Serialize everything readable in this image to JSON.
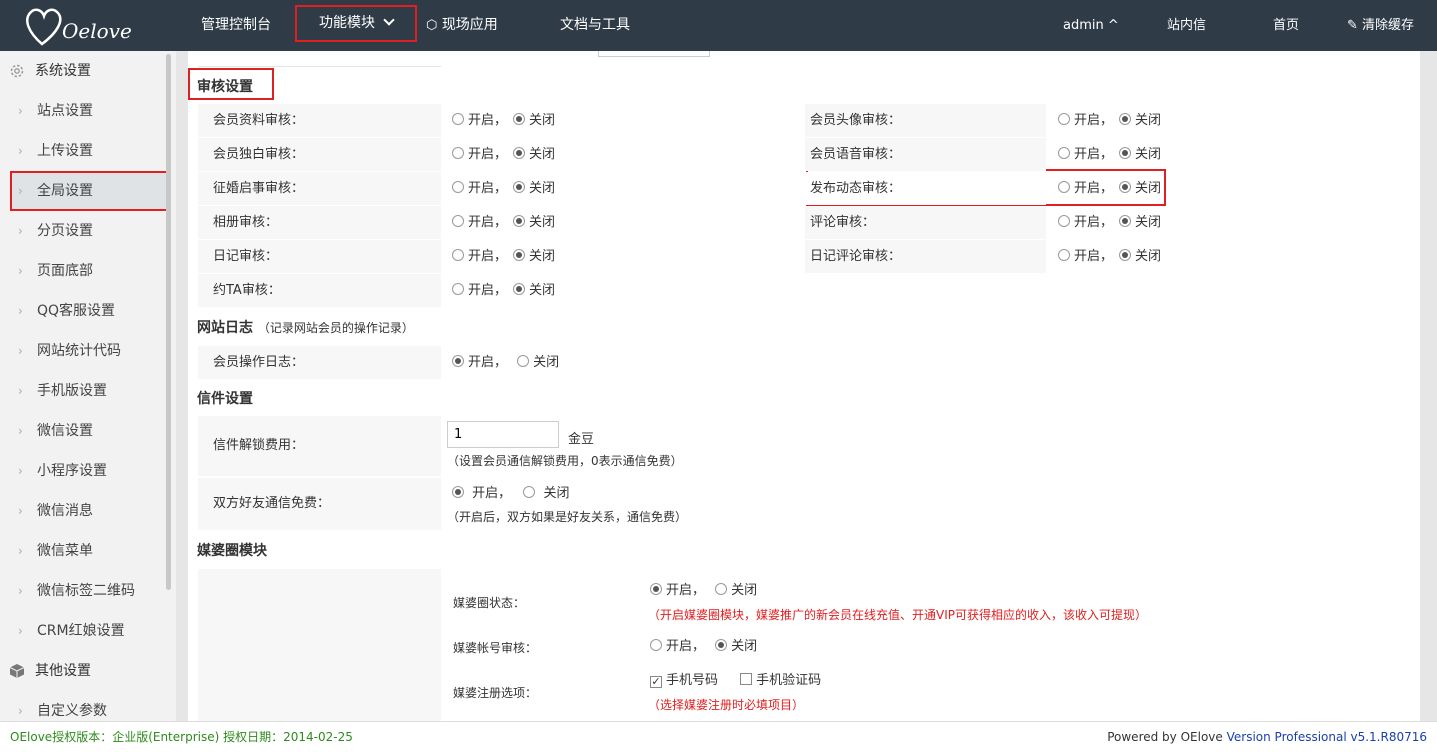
{
  "header": {
    "logo_text": "Oelove",
    "nav": [
      "管理控制台",
      "功能模块",
      "现场应用",
      "文档与工具"
    ],
    "user": "admin ^",
    "messages": "站内信",
    "home": "首页",
    "clear_cache": "清除缓存"
  },
  "sidebar": {
    "group1": "系统设置",
    "items": [
      "站点设置",
      "上传设置",
      "全局设置",
      "分页设置",
      "页面底部",
      "QQ客服设置",
      "网站统计代码",
      "手机版设置",
      "微信设置",
      "小程序设置",
      "微信消息",
      "微信菜单",
      "微信标签二维码",
      "CRM红娘设置"
    ],
    "group2": "其他设置",
    "items2": [
      "自定义参数"
    ]
  },
  "audit": {
    "title": "审核设置",
    "on": "开启，",
    "off": "关闭",
    "left": [
      "会员资料审核：",
      "会员独白审核：",
      "征婚启事审核：",
      "相册审核：",
      "日记审核：",
      "约TA审核："
    ],
    "right": [
      "会员头像审核：",
      "会员语音审核：",
      "发布动态审核：",
      "评论审核：",
      "日记评论审核："
    ]
  },
  "log": {
    "title": "网站日志",
    "note": "（记录网站会员的操作记录）",
    "label": "会员操作日志："
  },
  "letter": {
    "title": "信件设置",
    "fee_label": "信件解锁费用：",
    "fee_value": "1",
    "fee_unit": "金豆",
    "fee_hint": "（设置会员通信解锁费用，0表示通信免费）",
    "friend_label": "双方好友通信免费：",
    "friend_on": "开启，",
    "friend_off": "关闭",
    "friend_hint": "（开启后，双方如果是好友关系，通信免费）"
  },
  "mp": {
    "title": "媒婆圈模块",
    "status_label": "媒婆圈状态：",
    "status_hint": "（开启媒婆圈模块，媒婆推广的新会员在线充值、开通VIP可获得相应的收入，该收入可提现）",
    "audit_label": "媒婆帐号审核：",
    "reg_label": "媒婆注册选项：",
    "reg_opt1": "手机号码",
    "reg_opt2": "手机验证码",
    "reg_hint": "（选择媒婆注册时必填项目）"
  },
  "footer": {
    "license": "OElove授权版本：企业版(Enterprise) 授权日期：2014-02-25",
    "powered": "Powered by OElove",
    "version": "Version Professional v5.1.R80716"
  },
  "colors": {
    "topbar": "#2f3b47",
    "highlight": "#e02020",
    "footer_green": "#2e8b1d",
    "link_blue": "#1a3fb0"
  }
}
